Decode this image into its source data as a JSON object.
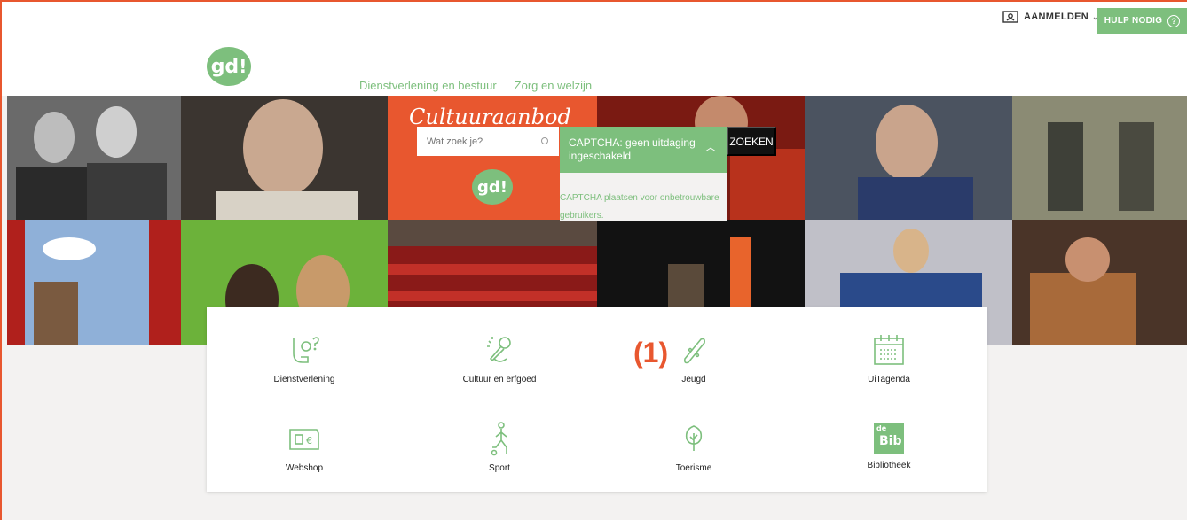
{
  "topbar": {
    "login_label": "AANMELDEN",
    "help_label": "HULP NODIG"
  },
  "header": {
    "logo_text": "gd",
    "nav": [
      "Dienstverlening en bestuur",
      "Zorg en welzijn"
    ]
  },
  "hero": {
    "banner_script": "Cultuuraanbod",
    "logo_text": "gd",
    "search_placeholder": "Wat zoek je?",
    "captcha_title": "CAPTCHA: geen uitdaging ingeschakeld",
    "captcha_text": "CAPTCHA plaatsen voor onbetrouwbare gebruikers.",
    "search_button": "ZOEKEN"
  },
  "annotation": "(1)",
  "tiles": [
    {
      "label": "Dienstverlening",
      "icon": "hand-question-icon"
    },
    {
      "label": "Cultuur en erfgoed",
      "icon": "microphone-icon"
    },
    {
      "label": "Jeugd",
      "icon": "skateboard-icon"
    },
    {
      "label": "UiTagenda",
      "icon": "calendar-icon"
    },
    {
      "label": "Webshop",
      "icon": "wallet-euro-icon"
    },
    {
      "label": "Sport",
      "icon": "runner-icon"
    },
    {
      "label": "Toerisme",
      "icon": "tree-icon"
    },
    {
      "label": "Bibliotheek",
      "icon": "de-bib-icon"
    }
  ],
  "bib_logo": {
    "line1": "de",
    "line2": "Bib"
  },
  "colors": {
    "accent": "#7dbf7d",
    "orange": "#e8572f",
    "background": "#f3f2f1"
  }
}
